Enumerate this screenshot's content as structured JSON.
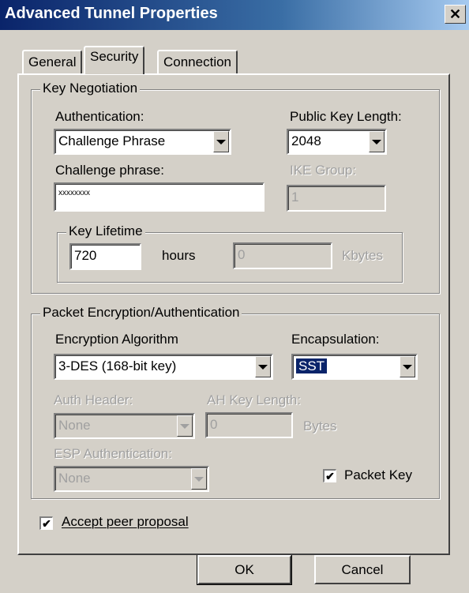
{
  "window": {
    "title": "Advanced Tunnel Properties",
    "close_glyph": "✕"
  },
  "tabs": [
    {
      "label": "General"
    },
    {
      "label": "Security"
    },
    {
      "label": "Connection"
    }
  ],
  "key_negotiation": {
    "group_label": "Key Negotiation",
    "authentication_label": "Authentication:",
    "authentication_value": "Challenge Phrase",
    "public_key_length_label": "Public Key Length:",
    "public_key_length_value": "2048",
    "challenge_phrase_label": "Challenge phrase:",
    "challenge_phrase_value": "xxxxxxxx",
    "ike_group_label": "IKE Group:",
    "ike_group_value": "1",
    "key_lifetime": {
      "group_label": "Key Lifetime",
      "hours_value": "720",
      "hours_unit": "hours",
      "kbytes_value": "0",
      "kbytes_unit": "Kbytes"
    }
  },
  "packet_encryption": {
    "group_label": "Packet Encryption/Authentication",
    "encryption_algorithm_label": "Encryption Algorithm",
    "encryption_algorithm_value": "3-DES (168-bit key)",
    "encapsulation_label": "Encapsulation:",
    "encapsulation_value": "SST",
    "auth_header_label": "Auth Header:",
    "auth_header_value": "None",
    "ah_key_length_label": "AH Key Length:",
    "ah_key_length_value": "0",
    "ah_key_length_unit": "Bytes",
    "esp_auth_label": "ESP Authentication:",
    "esp_auth_value": "None",
    "packet_key_label": "Packet Key",
    "packet_key_checked": "✔"
  },
  "accept_peer_proposal": {
    "label": "Accept peer proposal",
    "checked": "✔"
  },
  "buttons": {
    "ok": "OK",
    "cancel": "Cancel"
  }
}
